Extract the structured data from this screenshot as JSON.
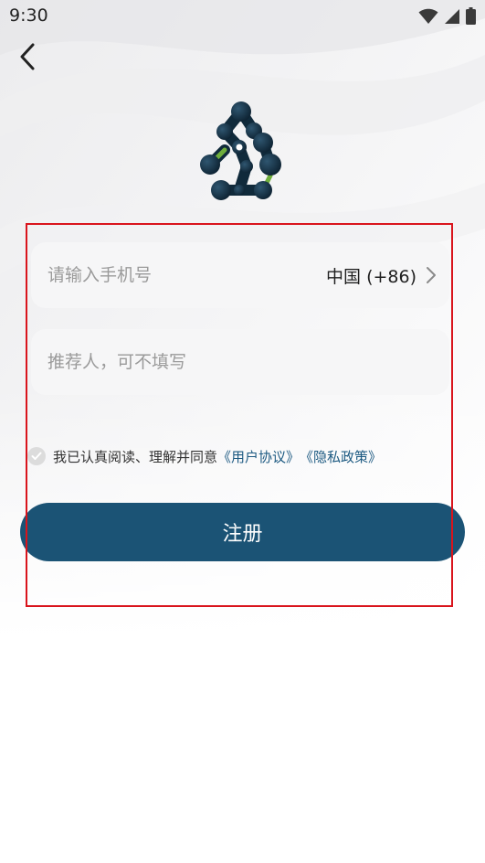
{
  "status_bar": {
    "time": "9:30",
    "icons": [
      "wifi-icon",
      "signal-icon",
      "battery-icon"
    ]
  },
  "header": {
    "back_icon": "chevron-left-icon"
  },
  "logo": {
    "icon": "molecule-logo-icon"
  },
  "form": {
    "phone": {
      "placeholder": "请输入手机号",
      "value": "",
      "country_label": "中国 (+86)",
      "country_icon": "chevron-right-icon"
    },
    "referrer": {
      "placeholder": "推荐人，可不填写",
      "value": ""
    },
    "agreement": {
      "checked": false,
      "text": "我已认真阅读、理解并同意",
      "user_agreement_link": "《用户协议》",
      "privacy_policy_link": "《隐私政策》"
    },
    "register_label": "注册"
  },
  "colors": {
    "primary": "#1b5375",
    "link": "#1d5a82",
    "logo_dark": "#0d2233",
    "logo_accent": "#6fae3c",
    "highlight": "#d9141c"
  }
}
